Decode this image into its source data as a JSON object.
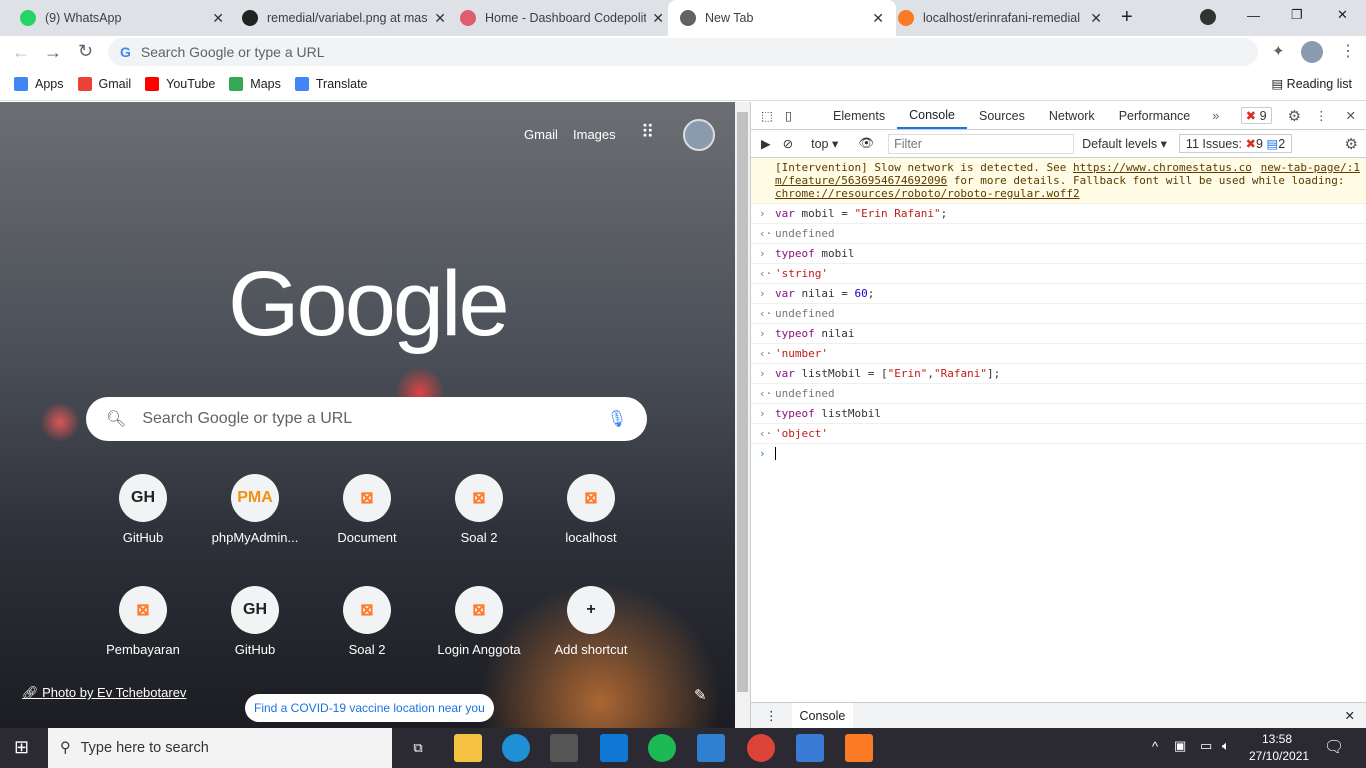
{
  "tabs": [
    {
      "title": "(9) WhatsApp",
      "icon": "whatsapp-icon",
      "color": "#25d366"
    },
    {
      "title": "remedial/variabel.png at mast",
      "icon": "github-icon",
      "color": "#222"
    },
    {
      "title": "Home - Dashboard Codepolit",
      "icon": "codepolitan-icon",
      "color": "#e05d6f"
    },
    {
      "title": "New Tab",
      "icon": "chrome-icon",
      "color": "#5f6368",
      "active": true
    },
    {
      "title": "localhost/erinrafani-remedial",
      "icon": "xampp-icon",
      "color": "#fb7a24"
    }
  ],
  "omnibox": {
    "placeholder": "Search Google or type a URL"
  },
  "bookmarks": [
    {
      "label": "Apps",
      "color": "#4285f4"
    },
    {
      "label": "Gmail",
      "color": "#ea4335"
    },
    {
      "label": "YouTube",
      "color": "#f00"
    },
    {
      "label": "Maps",
      "color": "#34a853"
    },
    {
      "label": "Translate",
      "color": "#4285f4"
    }
  ],
  "reading_list": "Reading list",
  "ntp": {
    "links": [
      "Gmail",
      "Images"
    ],
    "logo": "Google",
    "search_placeholder": "Search Google or type a URL",
    "shortcuts": [
      {
        "label": "GitHub",
        "glyph": "GH"
      },
      {
        "label": "phpMyAdmin...",
        "glyph": "PMA"
      },
      {
        "label": "Document",
        "glyph": "X"
      },
      {
        "label": "Soal 2",
        "glyph": "X"
      },
      {
        "label": "localhost",
        "glyph": "X"
      },
      {
        "label": "Pembayaran",
        "glyph": "X"
      },
      {
        "label": "GitHub",
        "glyph": "GH"
      },
      {
        "label": "Soal 2",
        "glyph": "X"
      },
      {
        "label": "Login Anggota",
        "glyph": "X"
      },
      {
        "label": "Add shortcut",
        "glyph": "+"
      }
    ],
    "photo_credit": "Photo by Ev Tchebotarev",
    "covid": "Find a COVID-19 vaccine location near you"
  },
  "devtools": {
    "tabs": [
      "Elements",
      "Console",
      "Sources",
      "Network",
      "Performance"
    ],
    "error_count": "9",
    "context": "top",
    "filter_placeholder": "Filter",
    "levels": "Default levels",
    "issues": "11 Issues:",
    "issues_err": "9",
    "issues_info": "2",
    "warning": {
      "text1": "[Intervention] Slow network is detected. See ",
      "link1": "https://www.chromestatus.com/feature/5636954674692096",
      "text2": " for more details. Fallback font will be used while loading: ",
      "link2": "chrome://resources/roboto/roboto-regular.woff2",
      "source": "new-tab-page/:1"
    },
    "lines": [
      {
        "t": "in",
        "parts": [
          [
            "kw",
            "var "
          ],
          [
            "vn",
            "mobil = "
          ],
          [
            "st",
            "\"Erin Rafani\""
          ],
          [
            "vn",
            ";"
          ]
        ]
      },
      {
        "t": "out",
        "parts": [
          [
            "gray",
            "undefined"
          ]
        ]
      },
      {
        "t": "in",
        "parts": [
          [
            "kw",
            "typeof "
          ],
          [
            "vn",
            "mobil"
          ]
        ]
      },
      {
        "t": "out",
        "parts": [
          [
            "st",
            "'string'"
          ]
        ]
      },
      {
        "t": "in",
        "parts": [
          [
            "kw",
            "var "
          ],
          [
            "vn",
            "nilai = "
          ],
          [
            "nm",
            "60"
          ],
          [
            "vn",
            ";"
          ]
        ]
      },
      {
        "t": "out",
        "parts": [
          [
            "gray",
            "undefined"
          ]
        ]
      },
      {
        "t": "in",
        "parts": [
          [
            "kw",
            "typeof "
          ],
          [
            "vn",
            "nilai"
          ]
        ]
      },
      {
        "t": "out",
        "parts": [
          [
            "st",
            "'number'"
          ]
        ]
      },
      {
        "t": "in",
        "parts": [
          [
            "kw",
            "var "
          ],
          [
            "vn",
            "listMobil = ["
          ],
          [
            "st",
            "\"Erin\""
          ],
          [
            "vn",
            ","
          ],
          [
            "st",
            "\"Rafani\""
          ],
          [
            "vn",
            "];"
          ]
        ]
      },
      {
        "t": "out",
        "parts": [
          [
            "gray",
            "undefined"
          ]
        ]
      },
      {
        "t": "in",
        "parts": [
          [
            "kw",
            "typeof "
          ],
          [
            "vn",
            "listMobil"
          ]
        ]
      },
      {
        "t": "out",
        "parts": [
          [
            "st",
            "'object'"
          ]
        ]
      }
    ],
    "drawer_tab": "Console"
  },
  "taskbar": {
    "search": "Type here to search",
    "time": "13:58",
    "date": "27/10/2021"
  }
}
